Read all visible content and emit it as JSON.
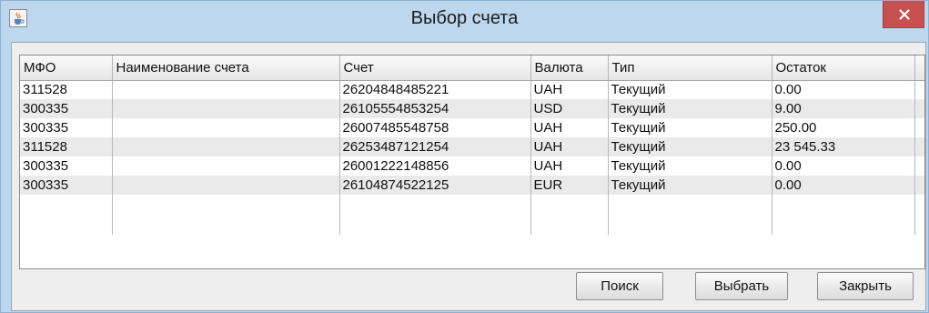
{
  "window": {
    "title": "Выбор счета",
    "icon": "java-cup-icon",
    "close_icon": "close-icon"
  },
  "table": {
    "columns": [
      "МФО",
      "Наименование счета",
      "Счет",
      "Валюта",
      "Тип",
      "Остаток"
    ],
    "rows": [
      {
        "mfo": "311528",
        "name": "",
        "account": "26204848485221",
        "currency": "UAH",
        "type": "Текущий",
        "balance": "0.00"
      },
      {
        "mfo": "300335",
        "name": "",
        "account": "26105554853254",
        "currency": "USD",
        "type": "Текущий",
        "balance": "9.00"
      },
      {
        "mfo": "300335",
        "name": "",
        "account": "26007485548758",
        "currency": "UAH",
        "type": "Текущий",
        "balance": "250.00"
      },
      {
        "mfo": "311528",
        "name": "",
        "account": "26253487121254",
        "currency": "UAH",
        "type": "Текущий",
        "balance": "23 545.33"
      },
      {
        "mfo": "300335",
        "name": "",
        "account": "26001222148856",
        "currency": "UAH",
        "type": "Текущий",
        "balance": "0.00"
      },
      {
        "mfo": "300335",
        "name": "",
        "account": "26104874522125",
        "currency": "EUR",
        "type": "Текущий",
        "balance": "0.00"
      }
    ]
  },
  "buttons": {
    "search": "Поиск",
    "select": "Выбрать",
    "close": "Закрыть"
  }
}
